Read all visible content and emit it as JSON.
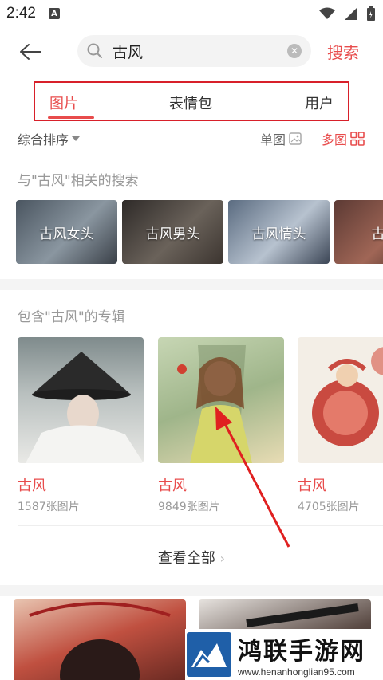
{
  "status": {
    "time": "2:42",
    "notif_letter": "A"
  },
  "search": {
    "query": "古风",
    "button_label": "搜索"
  },
  "tabs": [
    {
      "label": "图片",
      "active": true
    },
    {
      "label": "表情包",
      "active": false
    },
    {
      "label": "用户",
      "active": false
    }
  ],
  "filter": {
    "sort_label": "综合排序",
    "single_label": "单图",
    "multi_label": "多图"
  },
  "related": {
    "title": "与\"古风\"相关的搜索",
    "items": [
      "古风女头",
      "古风男头",
      "古风情头",
      "古风"
    ]
  },
  "albums": {
    "title": "包含\"古风\"的专辑",
    "items": [
      {
        "name": "古风",
        "count": "1587张图片"
      },
      {
        "name": "古风",
        "count": "9849张图片"
      },
      {
        "name": "古风",
        "count": "4705张图片"
      }
    ],
    "view_all_label": "查看全部"
  },
  "watermark": {
    "name": "鸿联手游网",
    "url": "www.henanhonglian95.com"
  },
  "colors": {
    "accent": "#e84c4c",
    "highlight_box": "#d8202a",
    "watermark_blue": "#1f5fa8"
  },
  "icons": [
    "back-arrow-icon",
    "search-icon",
    "clear-icon",
    "wifi-icon",
    "signal-icon",
    "battery-icon",
    "image-icon",
    "grid-icon",
    "chevron-right-icon",
    "caret-down-icon"
  ]
}
